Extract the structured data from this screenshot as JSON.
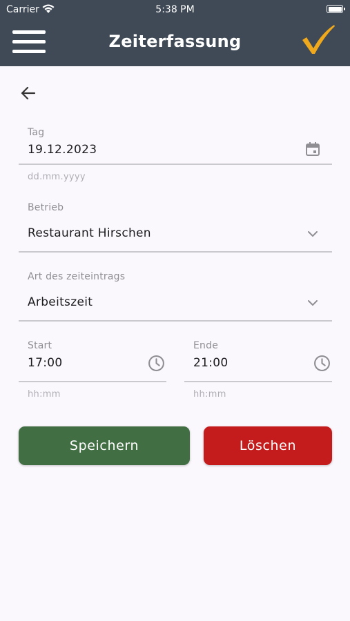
{
  "status_bar": {
    "carrier": "Carrier",
    "time": "5:38 PM"
  },
  "app_bar": {
    "title": "Zeiterfassung"
  },
  "form": {
    "date": {
      "label": "Tag",
      "value": "19.12.2023",
      "hint": "dd.mm.yyyy"
    },
    "business": {
      "label": "Betrieb",
      "value": "Restaurant Hirschen"
    },
    "entry_type": {
      "label": "Art des zeiteintrags",
      "value": "Arbeitszeit"
    },
    "start": {
      "label": "Start",
      "value": "17:00",
      "hint": "hh:mm"
    },
    "end": {
      "label": "Ende",
      "value": "21:00",
      "hint": "hh:mm"
    }
  },
  "buttons": {
    "save": "Speichern",
    "delete": "Löschen"
  },
  "colors": {
    "app_bar": "#3F4A56",
    "check_accent": "#F0A81C",
    "save": "#416E43",
    "delete": "#C41C1C",
    "background": "#FBF8FD"
  }
}
